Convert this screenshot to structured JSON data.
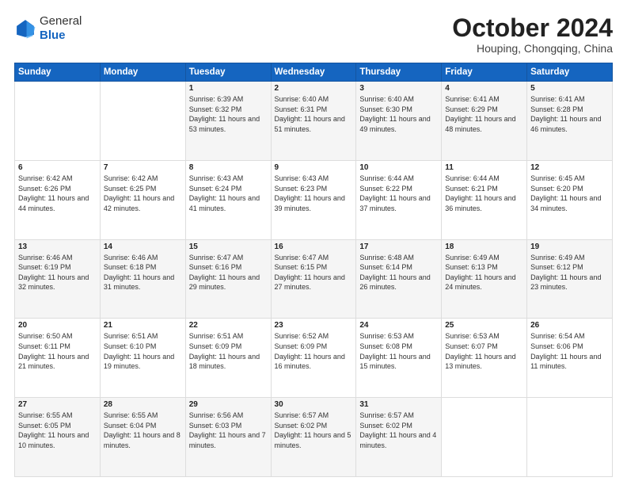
{
  "header": {
    "logo_line1": "General",
    "logo_line2": "Blue",
    "title": "October 2024",
    "location": "Houping, Chongqing, China"
  },
  "weekdays": [
    "Sunday",
    "Monday",
    "Tuesday",
    "Wednesday",
    "Thursday",
    "Friday",
    "Saturday"
  ],
  "weeks": [
    [
      {
        "day": "",
        "detail": ""
      },
      {
        "day": "",
        "detail": ""
      },
      {
        "day": "1",
        "detail": "Sunrise: 6:39 AM\nSunset: 6:32 PM\nDaylight: 11 hours and 53 minutes."
      },
      {
        "day": "2",
        "detail": "Sunrise: 6:40 AM\nSunset: 6:31 PM\nDaylight: 11 hours and 51 minutes."
      },
      {
        "day": "3",
        "detail": "Sunrise: 6:40 AM\nSunset: 6:30 PM\nDaylight: 11 hours and 49 minutes."
      },
      {
        "day": "4",
        "detail": "Sunrise: 6:41 AM\nSunset: 6:29 PM\nDaylight: 11 hours and 48 minutes."
      },
      {
        "day": "5",
        "detail": "Sunrise: 6:41 AM\nSunset: 6:28 PM\nDaylight: 11 hours and 46 minutes."
      }
    ],
    [
      {
        "day": "6",
        "detail": "Sunrise: 6:42 AM\nSunset: 6:26 PM\nDaylight: 11 hours and 44 minutes."
      },
      {
        "day": "7",
        "detail": "Sunrise: 6:42 AM\nSunset: 6:25 PM\nDaylight: 11 hours and 42 minutes."
      },
      {
        "day": "8",
        "detail": "Sunrise: 6:43 AM\nSunset: 6:24 PM\nDaylight: 11 hours and 41 minutes."
      },
      {
        "day": "9",
        "detail": "Sunrise: 6:43 AM\nSunset: 6:23 PM\nDaylight: 11 hours and 39 minutes."
      },
      {
        "day": "10",
        "detail": "Sunrise: 6:44 AM\nSunset: 6:22 PM\nDaylight: 11 hours and 37 minutes."
      },
      {
        "day": "11",
        "detail": "Sunrise: 6:44 AM\nSunset: 6:21 PM\nDaylight: 11 hours and 36 minutes."
      },
      {
        "day": "12",
        "detail": "Sunrise: 6:45 AM\nSunset: 6:20 PM\nDaylight: 11 hours and 34 minutes."
      }
    ],
    [
      {
        "day": "13",
        "detail": "Sunrise: 6:46 AM\nSunset: 6:19 PM\nDaylight: 11 hours and 32 minutes."
      },
      {
        "day": "14",
        "detail": "Sunrise: 6:46 AM\nSunset: 6:18 PM\nDaylight: 11 hours and 31 minutes."
      },
      {
        "day": "15",
        "detail": "Sunrise: 6:47 AM\nSunset: 6:16 PM\nDaylight: 11 hours and 29 minutes."
      },
      {
        "day": "16",
        "detail": "Sunrise: 6:47 AM\nSunset: 6:15 PM\nDaylight: 11 hours and 27 minutes."
      },
      {
        "day": "17",
        "detail": "Sunrise: 6:48 AM\nSunset: 6:14 PM\nDaylight: 11 hours and 26 minutes."
      },
      {
        "day": "18",
        "detail": "Sunrise: 6:49 AM\nSunset: 6:13 PM\nDaylight: 11 hours and 24 minutes."
      },
      {
        "day": "19",
        "detail": "Sunrise: 6:49 AM\nSunset: 6:12 PM\nDaylight: 11 hours and 23 minutes."
      }
    ],
    [
      {
        "day": "20",
        "detail": "Sunrise: 6:50 AM\nSunset: 6:11 PM\nDaylight: 11 hours and 21 minutes."
      },
      {
        "day": "21",
        "detail": "Sunrise: 6:51 AM\nSunset: 6:10 PM\nDaylight: 11 hours and 19 minutes."
      },
      {
        "day": "22",
        "detail": "Sunrise: 6:51 AM\nSunset: 6:09 PM\nDaylight: 11 hours and 18 minutes."
      },
      {
        "day": "23",
        "detail": "Sunrise: 6:52 AM\nSunset: 6:09 PM\nDaylight: 11 hours and 16 minutes."
      },
      {
        "day": "24",
        "detail": "Sunrise: 6:53 AM\nSunset: 6:08 PM\nDaylight: 11 hours and 15 minutes."
      },
      {
        "day": "25",
        "detail": "Sunrise: 6:53 AM\nSunset: 6:07 PM\nDaylight: 11 hours and 13 minutes."
      },
      {
        "day": "26",
        "detail": "Sunrise: 6:54 AM\nSunset: 6:06 PM\nDaylight: 11 hours and 11 minutes."
      }
    ],
    [
      {
        "day": "27",
        "detail": "Sunrise: 6:55 AM\nSunset: 6:05 PM\nDaylight: 11 hours and 10 minutes."
      },
      {
        "day": "28",
        "detail": "Sunrise: 6:55 AM\nSunset: 6:04 PM\nDaylight: 11 hours and 8 minutes."
      },
      {
        "day": "29",
        "detail": "Sunrise: 6:56 AM\nSunset: 6:03 PM\nDaylight: 11 hours and 7 minutes."
      },
      {
        "day": "30",
        "detail": "Sunrise: 6:57 AM\nSunset: 6:02 PM\nDaylight: 11 hours and 5 minutes."
      },
      {
        "day": "31",
        "detail": "Sunrise: 6:57 AM\nSunset: 6:02 PM\nDaylight: 11 hours and 4 minutes."
      },
      {
        "day": "",
        "detail": ""
      },
      {
        "day": "",
        "detail": ""
      }
    ]
  ]
}
